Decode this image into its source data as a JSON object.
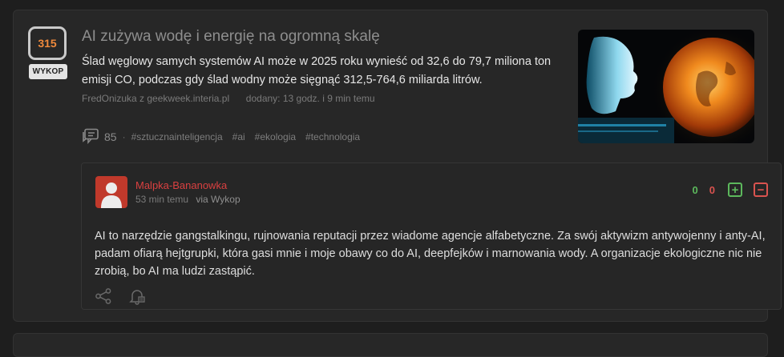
{
  "post": {
    "score": "315",
    "vote_label": "WYKOP",
    "title": "AI zużywa wodę i energię na ogromną skalę",
    "description": "Ślad węglowy samych systemów AI może w 2025 roku wynieść od 32,6 do 79,7 miliona ton emisji CO, podczas gdy ślad wodny może sięgnąć 312,5-764,6 miliarda litrów.",
    "author": "FredOnizuka",
    "source": "z geekweek.interia.pl",
    "added": "dodany: 13 godz. i 9 min temu",
    "comment_count": "85",
    "tags": [
      "#sztucznainteligencja",
      "#ai",
      "#ekologia",
      "#technologia"
    ]
  },
  "comment": {
    "author": "Malpka-Bananowka",
    "time": "53 min temu",
    "via": "via Wykop",
    "votes_up": "0",
    "votes_down": "0",
    "text": "AI to narzędzie gangstalkingu, rujnowania reputacji przez wiadome agencje alfabetyczne. Za swój aktywizm antywojenny i anty-AI, padam ofiarą hejtgrupki, która gasi mnie i moje obawy co do AI, deepfejków i marnowania wody. A organizacje ekologiczne nic nie zrobią, bo AI ma ludzi zastąpić."
  },
  "icons": {
    "comments": "comments-icon",
    "share": "share-icon",
    "notify": "bell-icon",
    "upvote": "plus-icon",
    "downvote": "minus-icon"
  },
  "colors": {
    "score": "#f08a3c",
    "author": "#d94040",
    "positive": "#5cb85c",
    "negative": "#d9534f"
  }
}
